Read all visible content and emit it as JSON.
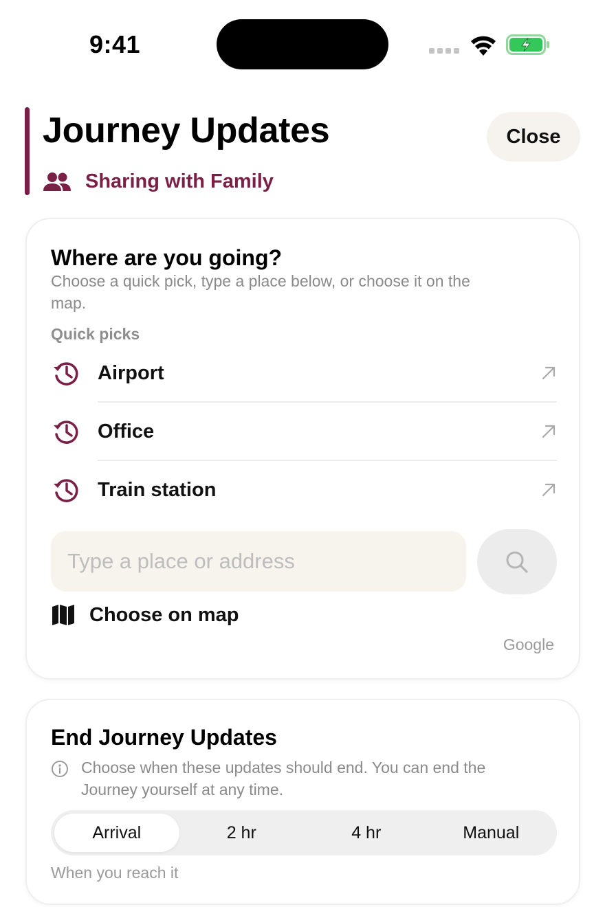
{
  "status_bar": {
    "time": "9:41"
  },
  "colors": {
    "accent": "#7a1f45",
    "battery_green": "#34c759"
  },
  "header": {
    "title": "Journey Updates",
    "sharing_label": "Sharing with Family",
    "close_label": "Close",
    "sharing_icon": "people-icon"
  },
  "destination": {
    "title": "Where are you going?",
    "subtitle": "Choose a quick pick, type a place below, or choose it on the map.",
    "quick_picks_label": "Quick picks",
    "quick_picks": [
      {
        "label": "Airport",
        "icon": "history-icon"
      },
      {
        "label": "Office",
        "icon": "history-icon"
      },
      {
        "label": "Train station",
        "icon": "history-icon"
      }
    ],
    "search_placeholder": "Type a place or address",
    "search_value": "",
    "choose_on_map_label": "Choose on map",
    "attribution": "Google"
  },
  "end_updates": {
    "title": "End Journey Updates",
    "subtitle": "Choose when these updates should end. You can end the Journey yourself at any time.",
    "options": [
      "Arrival",
      "2 hr",
      "4 hr",
      "Manual"
    ],
    "selected": "Arrival",
    "hint": "When you reach it"
  }
}
